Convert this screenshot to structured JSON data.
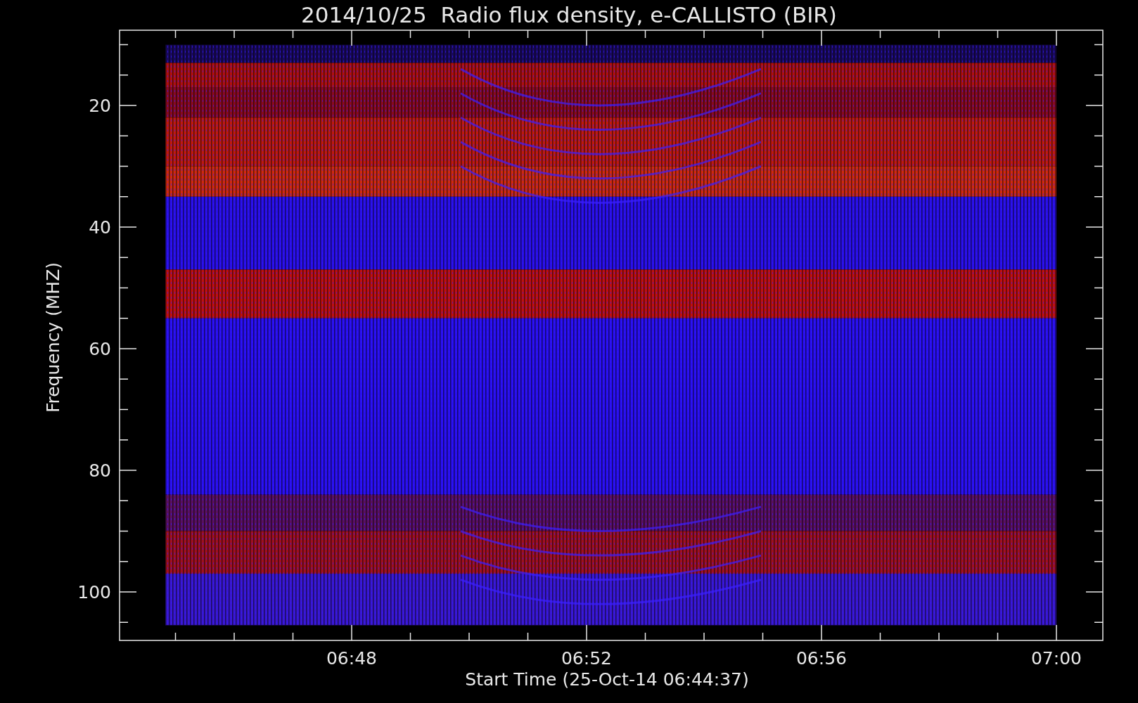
{
  "title": "2014/10/25  Radio flux density, e-CALLISTO (BIR)",
  "y_axis": {
    "title": "Frequency (MHZ)",
    "ticks": [
      "20",
      "40",
      "60",
      "80",
      "100"
    ]
  },
  "x_axis": {
    "title": "Start Time (25-Oct-14 06:44:37)",
    "ticks": [
      "06:48",
      "06:52",
      "06:56",
      "07:00"
    ]
  }
}
